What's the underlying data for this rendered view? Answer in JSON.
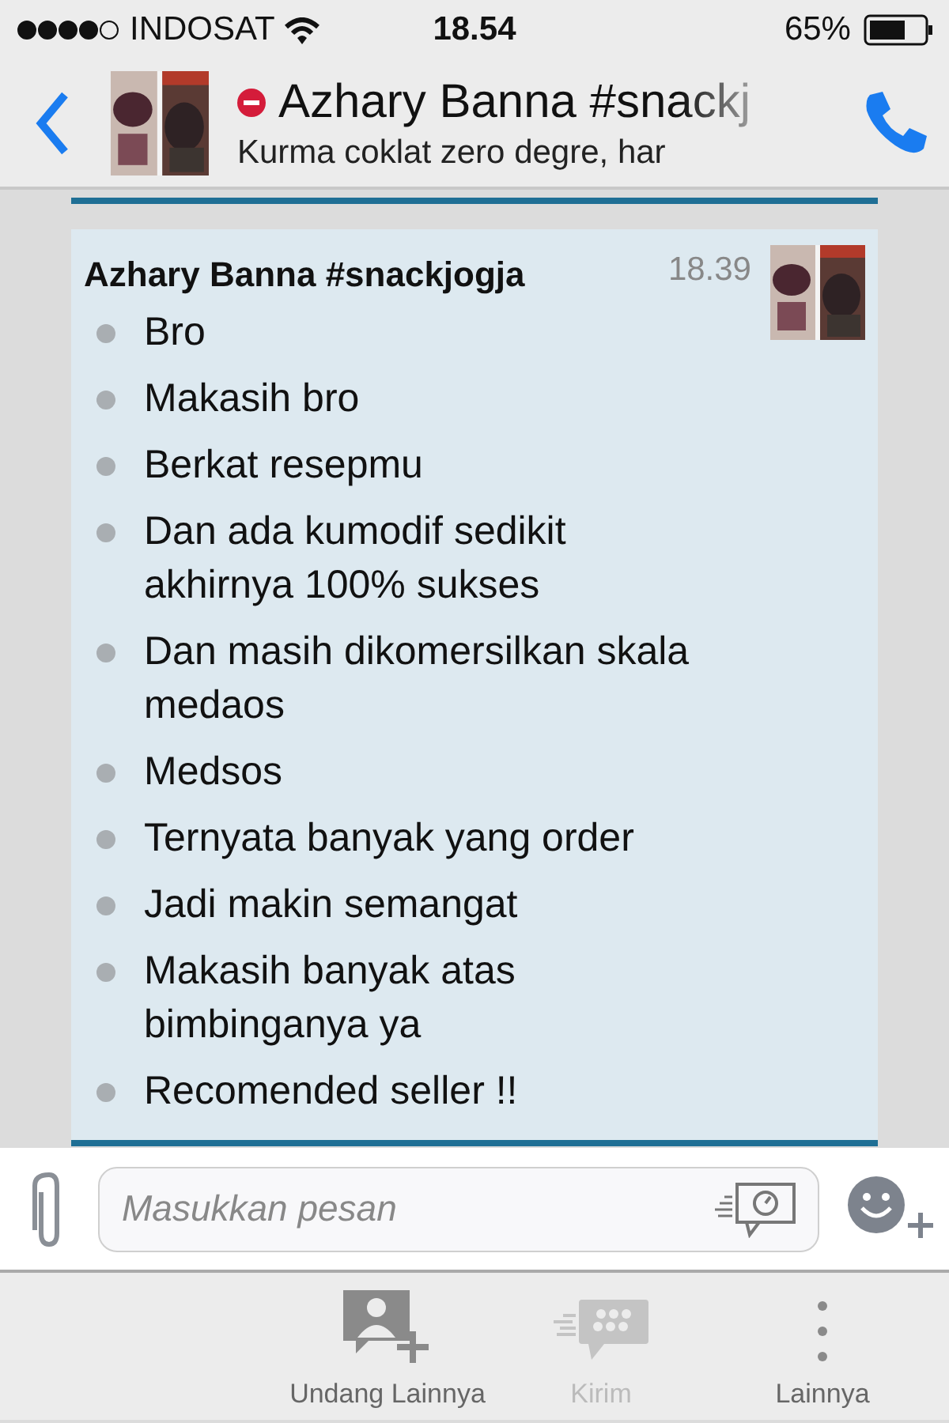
{
  "status_bar": {
    "carrier": "INDOSAT",
    "time": "18.54",
    "battery": "65%"
  },
  "header": {
    "title": "Azhary Banna #snackj",
    "subtitle": "Kurma coklat zero degre, har"
  },
  "message": {
    "sender": "Azhary Banna #snackjogja",
    "time": "18.39",
    "lines": [
      "Bro",
      "Makasih bro",
      "Berkat resepmu",
      "Dan ada kumodif sedikit akhirnya 100% sukses",
      "Dan masih dikomersilkan skala medaos",
      "Medsos",
      "Ternyata banyak yang order",
      "Jadi makin semangat",
      "Makasih banyak atas bimbinganya ya",
      "Recomended seller !!"
    ]
  },
  "composer": {
    "placeholder": "Masukkan pesan"
  },
  "toolbar": [
    {
      "kind": "invite",
      "label": "Undang Lainnya",
      "disabled": false
    },
    {
      "kind": "send",
      "label": "Kirim",
      "disabled": true
    },
    {
      "kind": "more",
      "label": "Lainnya",
      "disabled": false
    }
  ]
}
